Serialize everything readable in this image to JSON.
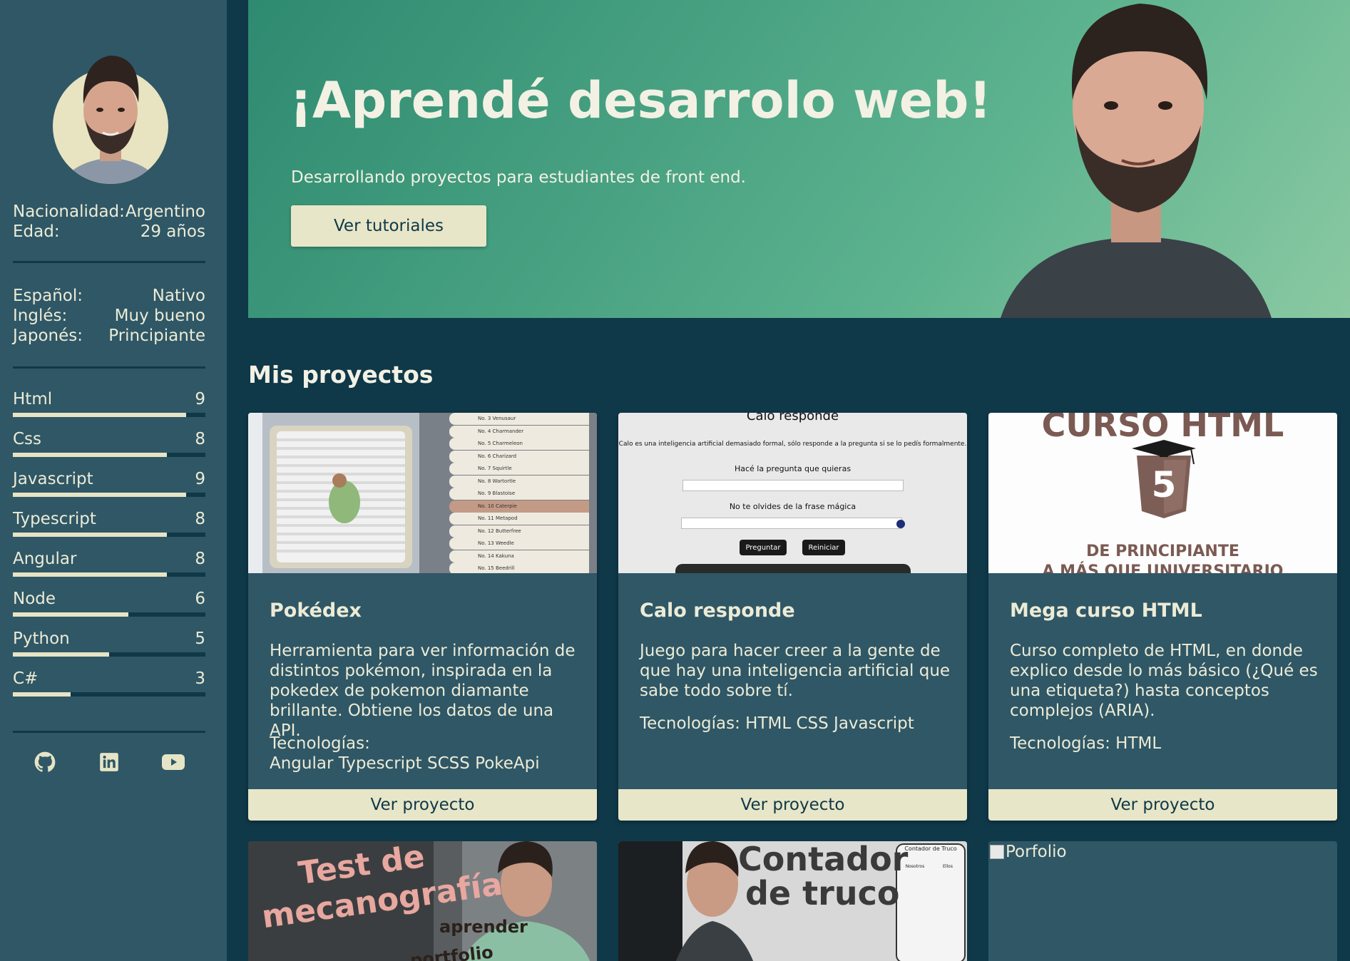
{
  "sidebar": {
    "info": [
      {
        "label": "Nacionalidad:",
        "value": "Argentino"
      },
      {
        "label": "Edad:",
        "value": "29 años"
      }
    ],
    "languages": [
      {
        "label": "Español:",
        "value": "Nativo"
      },
      {
        "label": "Inglés:",
        "value": "Muy bueno"
      },
      {
        "label": "Japonés:",
        "value": "Principiante"
      }
    ],
    "skills": [
      {
        "name": "Html",
        "level": "9",
        "fraction": 0.9
      },
      {
        "name": "Css",
        "level": "8",
        "fraction": 0.8
      },
      {
        "name": "Javascript",
        "level": "9",
        "fraction": 0.9
      },
      {
        "name": "Typescript",
        "level": "8",
        "fraction": 0.8
      },
      {
        "name": "Angular",
        "level": "8",
        "fraction": 0.8
      },
      {
        "name": "Node",
        "level": "6",
        "fraction": 0.6
      },
      {
        "name": "Python",
        "level": "5",
        "fraction": 0.5
      },
      {
        "name": "C#",
        "level": "3",
        "fraction": 0.3
      }
    ],
    "socials": [
      "github-icon",
      "linkedin-icon",
      "youtube-icon"
    ]
  },
  "hero": {
    "title": "¡Aprendé desarrolo web!",
    "subtitle": "Desarrollando proyectos para estudiantes de front end.",
    "button": "Ver tutoriales"
  },
  "projects_title": "Mis proyectos",
  "projects": [
    {
      "title": "Pokédex",
      "description": "Herramienta para ver información de distintos pokémon, inspirada en la pokedex de pokemon diamante brillante. Obtiene los datos de una API.",
      "tech_label": "Tecnologías:",
      "tech": "Angular Typescript SCSS PokeApi",
      "button": "Ver proyecto",
      "thumb": {
        "list": [
          "No. 3  Venusaur",
          "No. 4  Charmander",
          "No. 5  Charmeleon",
          "No. 6  Charizard",
          "No. 7  Squirtle",
          "No. 8  Wartortle",
          "No. 9  Blastoise",
          "No. 10  Caterpie",
          "No. 11  Metapod",
          "No. 12  Butterfree",
          "No. 13  Weedle",
          "No. 14  Kakuna",
          "No. 15  Beedrill"
        ]
      }
    },
    {
      "title": "Calo responde",
      "description": "Juego para hacer creer a la gente de que hay una inteligencia artificial que sabe todo sobre tí.",
      "tech_label": "Tecnologías: HTML CSS Javascript",
      "tech": "",
      "button": "Ver proyecto",
      "thumb": {
        "heading": "Calo responde",
        "intro": "Calo es una inteligencia artificial demasiado formal, sólo responde a la pregunta si se lo pedís formalmente.",
        "q_label": "Hacé la pregunta que quieras",
        "magic_label": "No te olvides de la frase mágica",
        "ask": "Preguntar",
        "reset": "Reiniciar"
      }
    },
    {
      "title": "Mega curso HTML",
      "description": "Curso completo de HTML, en donde explico desde lo más básico (¿Qué es una etiqueta?) hasta conceptos complejos (ARIA).",
      "tech_label": "Tecnologías: HTML",
      "tech": "",
      "button": "Ver proyecto",
      "thumb": {
        "top": "CURSO HTML",
        "badge": "5",
        "line1": "DE PRINCIPIANTE",
        "line2": "A MÁS QUE UNIVERSITARIO"
      }
    }
  ],
  "bottom_cards": [
    {
      "thumb_line1": "Test de",
      "thumb_line2": "mecanografía",
      "thumb_line3": "aprender",
      "thumb_line4": "portfolio  programar"
    },
    {
      "thumb_line1": "Contador",
      "thumb_line2": "de truco",
      "thumb_panel": "Contador de Truco",
      "thumb_col1": "Nosotros",
      "thumb_col2": "Ellos"
    },
    {
      "alt": "Porfolio"
    }
  ]
}
